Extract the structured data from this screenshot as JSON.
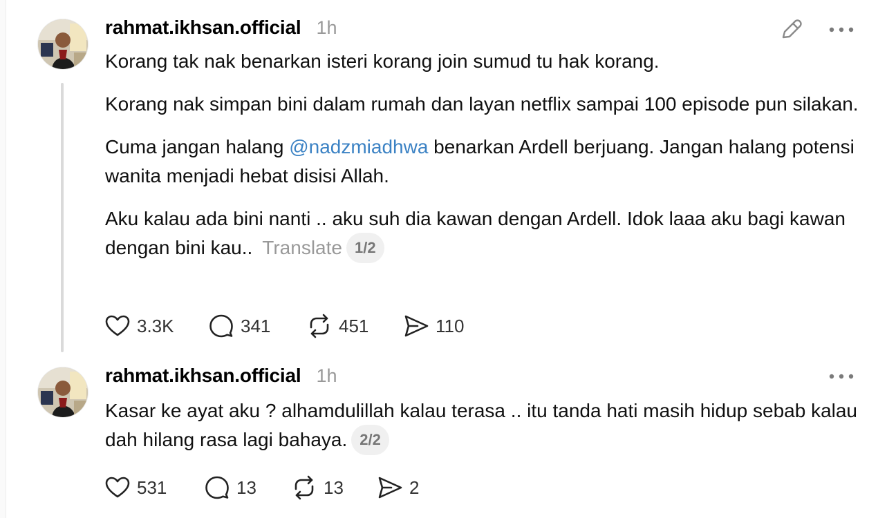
{
  "posts": [
    {
      "username": "rahmat.ikhsan.official",
      "time": "1h",
      "paragraphs": [
        "Korang tak nak benarkan isteri korang join sumud tu hak korang.",
        "Korang nak simpan bini dalam rumah dan layan netflix sampai 100 episode pun silakan."
      ],
      "para3_before": "Cuma jangan halang ",
      "para3_mention": "@nadzmiadhwa",
      "para3_after": " benarkan Ardell berjuang. Jangan halang potensi wanita menjadi hebat disisi Allah.",
      "para4": "Aku kalau ada bini nanti .. aku suh dia kawan dengan Ardell. Idok laaa aku bagi kawan dengan bini kau..",
      "translate": "Translate",
      "page": "1/2",
      "likes": "3.3K",
      "replies": "341",
      "reposts": "451",
      "shares": "110",
      "icons": [
        "edit-icon",
        "more-icon",
        "heart-icon",
        "comment-icon",
        "repost-icon",
        "share-icon"
      ]
    },
    {
      "username": "rahmat.ikhsan.official",
      "time": "1h",
      "text": "Kasar ke ayat aku ? alhamdulillah kalau terasa .. itu tanda hati masih hidup sebab kalau dah hilang rasa lagi bahaya.",
      "page": "2/2",
      "likes": "531",
      "replies": "13",
      "reposts": "13",
      "shares": "2",
      "icons": [
        "more-icon",
        "heart-icon",
        "comment-icon",
        "repost-icon",
        "share-icon"
      ]
    }
  ],
  "colors": {
    "mention": "#3b82c4",
    "muted": "#999999",
    "thread_line": "#dadada",
    "badge_bg": "#f0f0f0"
  }
}
